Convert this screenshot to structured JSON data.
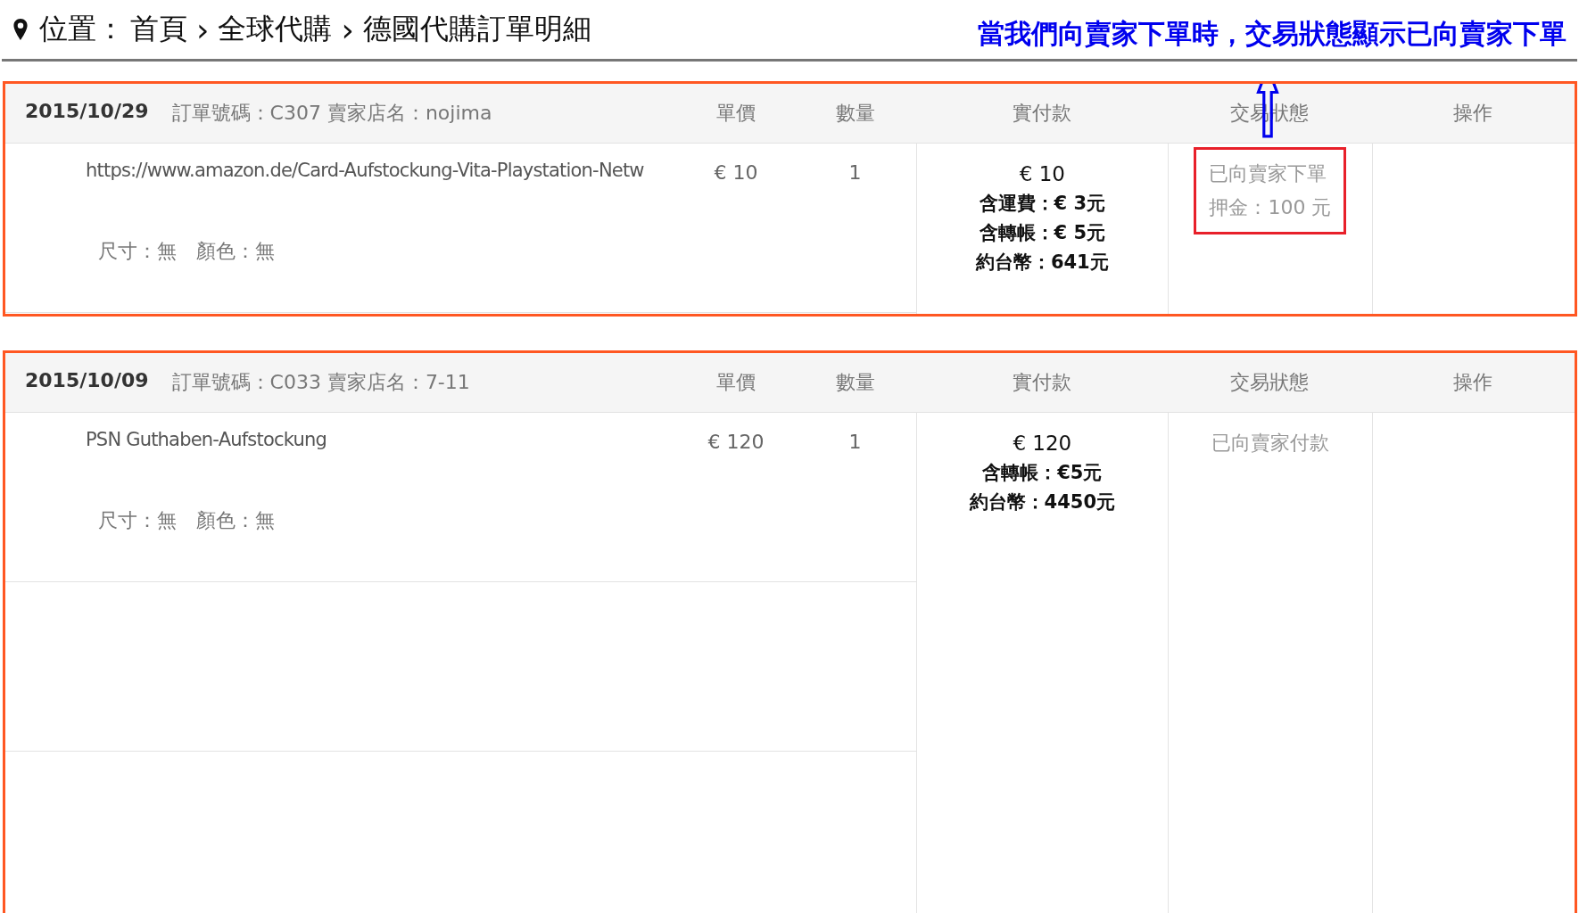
{
  "breadcrumb": {
    "label": "位置：",
    "items": [
      {
        "label": "首頁"
      },
      {
        "separator": "›",
        "label": "全球代購"
      },
      {
        "separator": "›",
        "label": "德國代購訂單明細"
      }
    ]
  },
  "annotation": {
    "text": "當我們向賣家下單時，交易狀態顯示已向賣家下單"
  },
  "orders": [
    {
      "date": "2015/10/29",
      "order_info": "訂單號碼：C307 賣家店名：nojima",
      "columns": [
        "單價",
        "數量",
        "實付款",
        "交易狀態",
        "操作"
      ],
      "product": "https://www.amazon.de/Card-Aufstockung-Vita-Playstation-Netw",
      "specs": "尺寸：無　顏色：無",
      "price": "€ 10",
      "quantity": "1",
      "paid": [
        "€ 10",
        "含運費：€ 3元",
        "含轉帳：€ 5元",
        "約台幣：641元"
      ],
      "status": [
        "已向賣家下單",
        "押金：100 元"
      ],
      "highlighted": true,
      "extra_rows": false
    },
    {
      "date": "2015/10/09",
      "order_info": "訂單號碼：C033 賣家店名：7-11",
      "columns": [
        "單價",
        "數量",
        "實付款",
        "交易狀態",
        "操作"
      ],
      "product": "PSN Guthaben-Aufstockung",
      "specs": "尺寸：無　顏色：無",
      "price": "€ 120",
      "quantity": "1",
      "paid": [
        "€ 120",
        "含轉帳：€5元",
        "約台幣：4450元"
      ],
      "status": [
        "已向賣家付款"
      ],
      "highlighted": false,
      "extra_rows": true
    }
  ]
}
